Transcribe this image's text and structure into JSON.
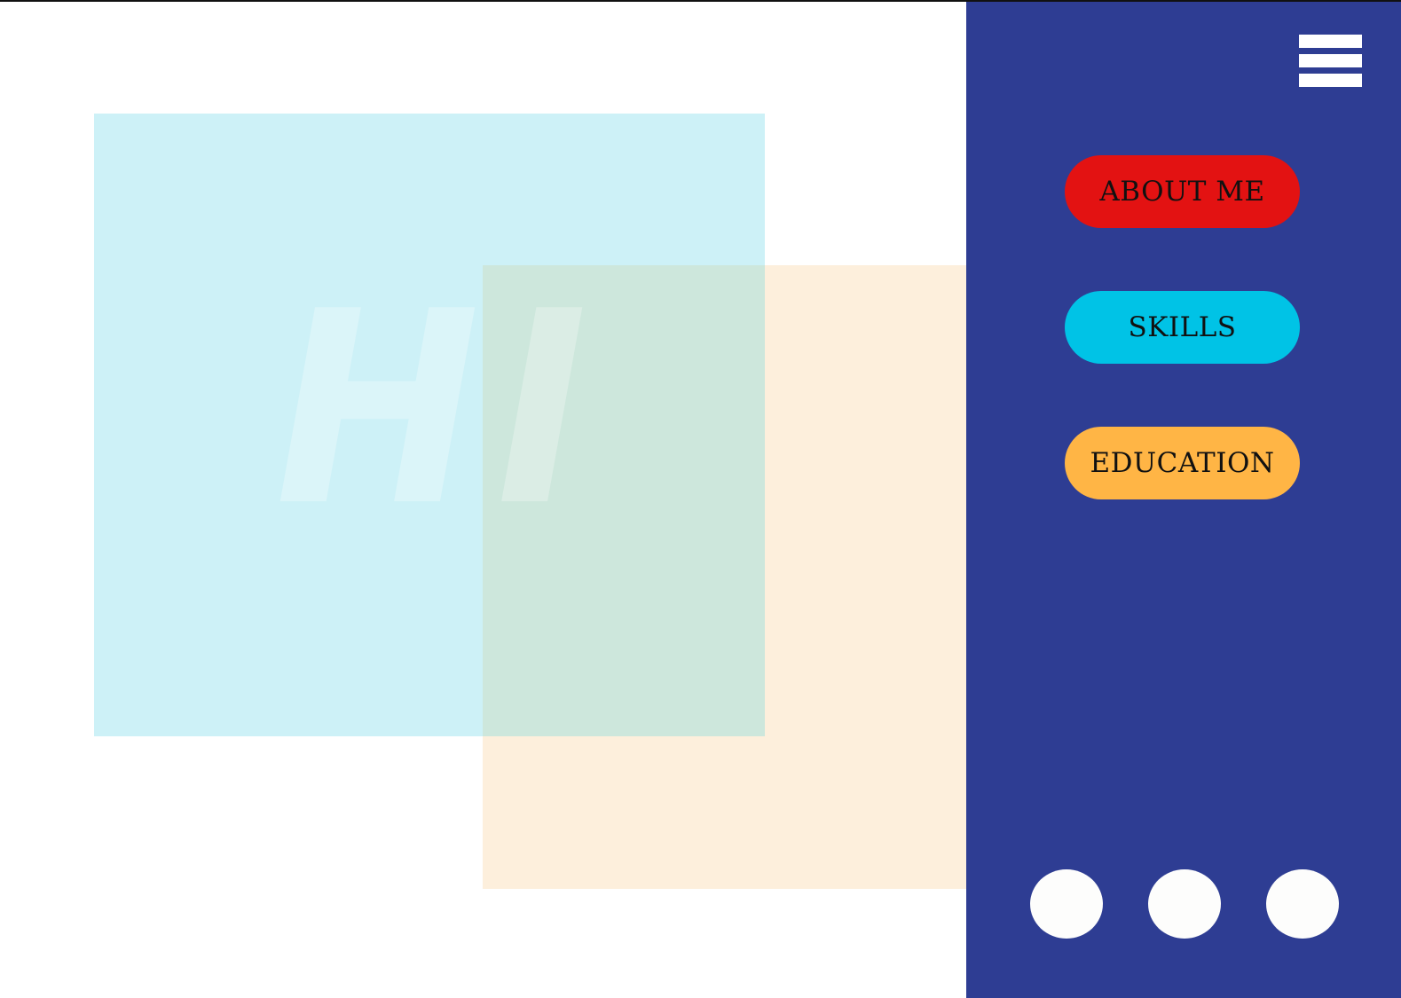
{
  "hero": {
    "text": "HI"
  },
  "nav": {
    "items": [
      {
        "label": "ABOUT ME",
        "color": "#e31212"
      },
      {
        "label": "SKILLS",
        "color": "#00c3e6"
      },
      {
        "label": "EDUCATION",
        "color": "#ffb545"
      }
    ]
  },
  "menu": {
    "icon": "hamburger-menu-icon"
  },
  "colors": {
    "sidebar": "#2e3d93",
    "panel_cyan": "#cdf1f7",
    "panel_peach": "#fdefdc",
    "panel_overlap": "#cde7dc",
    "dots": "#fdfdfc"
  },
  "pagination": {
    "dot_count": 3
  }
}
